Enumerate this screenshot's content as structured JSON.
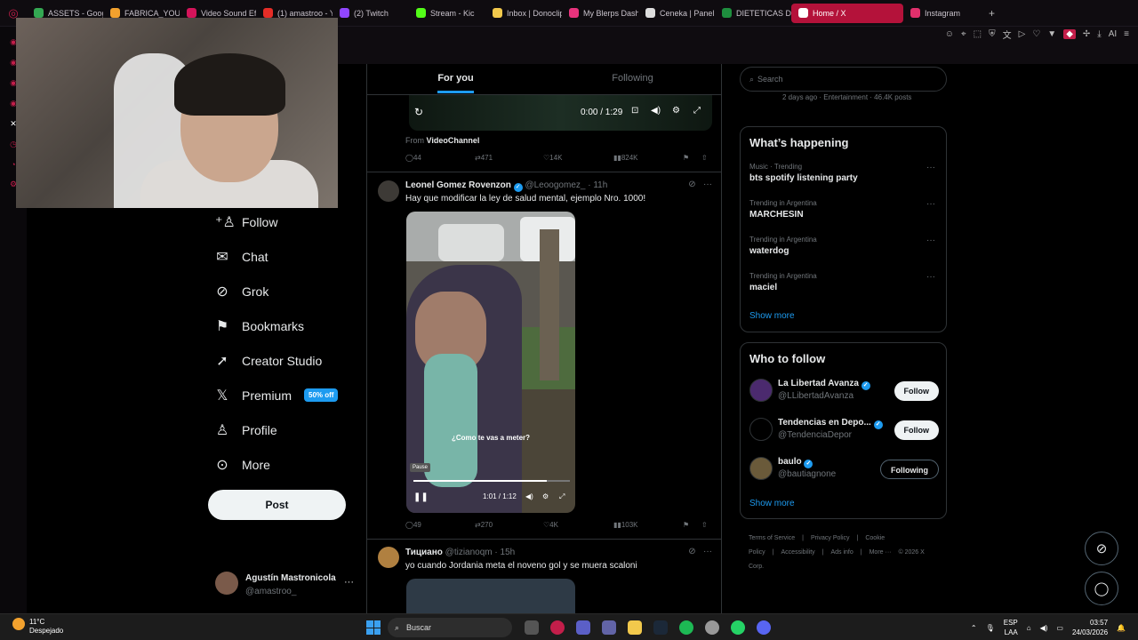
{
  "browser": {
    "tabs": [
      {
        "label": "ASSETS - Goog",
        "color": "#34a853"
      },
      {
        "label": "FABRICA_YOUT",
        "color": "#f2a12e"
      },
      {
        "label": "Video Sound Eff",
        "color": "#d4145a"
      },
      {
        "label": "(1) amastroo - Y",
        "color": "#e52d27"
      },
      {
        "label": "(2) Twitch",
        "color": "#9146ff"
      },
      {
        "label": "Stream - Kic",
        "color": "#53fc18"
      },
      {
        "label": "Inbox | Donoclip",
        "color": "#f2c94c"
      },
      {
        "label": "My Blerps Dash",
        "color": "#e8337d"
      },
      {
        "label": "Ceneka | Panel",
        "color": "#dddddd"
      },
      {
        "label": "DIETETICAS DIS",
        "color": "#1e8e3e"
      },
      {
        "label": "Home / X",
        "color": "#ffffff"
      },
      {
        "label": "Instagram",
        "color": "#e1306c"
      }
    ],
    "active_tab": 10,
    "accent": "#b4123a",
    "ai_label": "AI"
  },
  "nav": {
    "items": [
      {
        "label": "Follow",
        "icon": "person-plus-icon",
        "glyph": "⁺♙"
      },
      {
        "label": "Chat",
        "icon": "mail-icon",
        "glyph": "✉"
      },
      {
        "label": "Grok",
        "icon": "grok-icon",
        "glyph": "⊘"
      },
      {
        "label": "Bookmarks",
        "icon": "bookmark-icon",
        "glyph": "⚑"
      },
      {
        "label": "Creator Studio",
        "icon": "rocket-icon",
        "glyph": "➚"
      },
      {
        "label": "Premium",
        "icon": "x-logo-icon",
        "glyph": "𝕏",
        "badge": "50% off"
      },
      {
        "label": "Profile",
        "icon": "person-icon",
        "glyph": "♙"
      },
      {
        "label": "More",
        "icon": "more-circle-icon",
        "glyph": "⊙"
      }
    ],
    "post_label": "Post",
    "account": {
      "name": "Agustín Mastronicola",
      "handle": "@amastroo_"
    }
  },
  "feed": {
    "tabs": [
      "For you",
      "Following"
    ],
    "active_tab": 0,
    "video1": {
      "time": "0:00 / 1:29",
      "from_label": "From",
      "from_channel": "VideoChannel"
    },
    "post1_actions": {
      "replies": "44",
      "reposts": "471",
      "likes": "14K",
      "views": "824K"
    },
    "post2": {
      "name": "Leonel Gomez Rovenzon",
      "handle": "@Leoogomez_",
      "time": "· 11h",
      "text": "Hay que modificar la ley de salud mental, ejemplo Nro. 1000!",
      "caption": "¿Como te vas a meter?",
      "tooltip": "Pause",
      "video_time": "1:01 / 1:12",
      "progress": 0.85,
      "replies": "49",
      "reposts": "270",
      "likes": "4K",
      "views": "103K"
    },
    "post3": {
      "name": "Тициано",
      "handle": "@tizianoqm",
      "time": "· 15h",
      "text": "yo cuando Jordania meta el noveno gol y se muera scaloni"
    }
  },
  "sidebar": {
    "search_placeholder": "Search",
    "top_trend_meta": "2 days ago · Entertainment · 46.4K posts",
    "happening_title": "What’s happening",
    "trends": [
      {
        "context": "Music · Trending",
        "name": "bts spotify listening party"
      },
      {
        "context": "Trending in Argentina",
        "name": "MARCHESIN"
      },
      {
        "context": "Trending in Argentina",
        "name": "waterdog"
      },
      {
        "context": "Trending in Argentina",
        "name": "maciel"
      }
    ],
    "show_more": "Show more",
    "wtf_title": "Who to follow",
    "who_to_follow": [
      {
        "name": "La Libertad Avanza",
        "handle": "@LLibertadAvanza",
        "button": "Follow",
        "state": "follow",
        "color": "#4b2a6e"
      },
      {
        "name": "Tendencias en Depo...",
        "handle": "@TendenciaDepor",
        "button": "Follow",
        "state": "follow",
        "color": "#000000"
      },
      {
        "name": "baulo",
        "handle": "@bautiagnone",
        "button": "Following",
        "state": "following",
        "color": "#6a5a3a"
      }
    ],
    "footer": [
      "Terms of Service",
      "|",
      "Privacy Policy",
      "|",
      "Cookie Policy",
      "|",
      "Accessibility",
      "|",
      "Ads info",
      "|",
      "More ···",
      "© 2026 X Corp."
    ]
  },
  "taskbar": {
    "temperature": "11°C",
    "weather": "Despejado",
    "search": "Buscar",
    "lang": "ESP",
    "layout": "LAA",
    "time": "03:57",
    "date": "24/03/2026"
  }
}
